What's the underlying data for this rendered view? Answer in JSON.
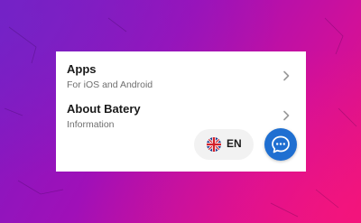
{
  "menu": {
    "items": [
      {
        "title": "Apps",
        "subtitle": "For iOS and Android",
        "icon": "chevron-right-icon"
      },
      {
        "title": "About Batery",
        "subtitle": "Information",
        "icon": "chevron-right-icon"
      }
    ]
  },
  "language_switch": {
    "label": "EN",
    "icon": "uk-flag-icon"
  },
  "chat": {
    "icon": "chat-bubble-icon",
    "color": "#1f6fd1"
  },
  "colors": {
    "background_start": "#7a1cc4",
    "background_end": "#e8157e",
    "panel": "#ffffff"
  }
}
